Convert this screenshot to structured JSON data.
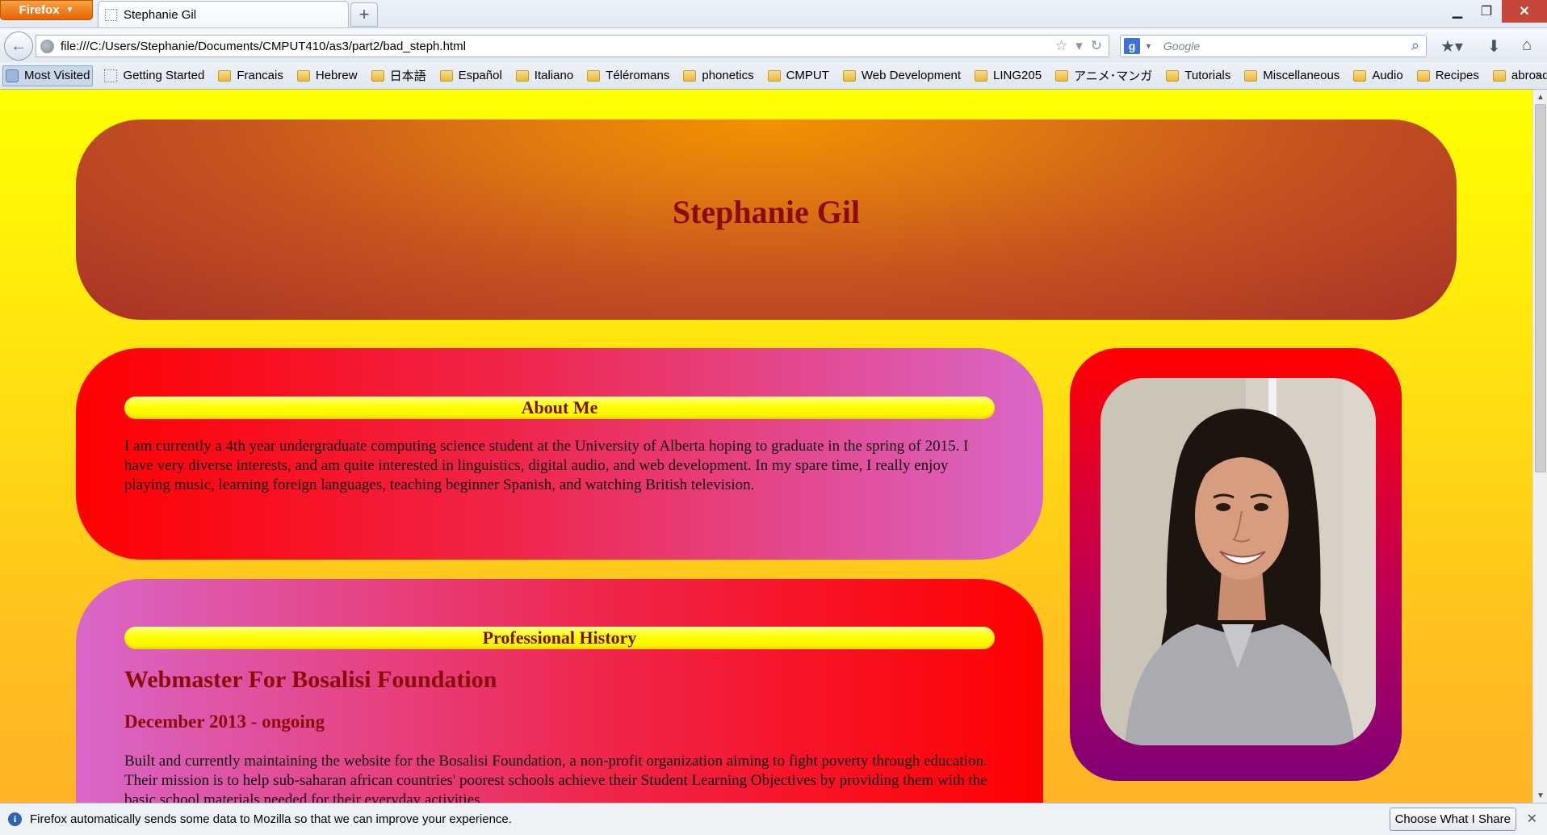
{
  "browser": {
    "app_button": "Firefox",
    "tab_title": "Stephanie Gil",
    "url": "file:///C:/Users/Stephanie/Documents/CMPUT410/as3/part2/bad_steph.html",
    "search_placeholder": "Google",
    "search_engine_letter": "g",
    "bookmarks": [
      "Most Visited",
      "Getting Started",
      "Francais",
      "Hebrew",
      "日本語",
      "Español",
      "Italiano",
      "Téléromans",
      "phonetics",
      "CMPUT",
      "Web Development",
      "LING205",
      "アニメ･マンガ",
      "Tutorials",
      "Miscellaneous",
      "Audio",
      "Recipes",
      "abroad"
    ],
    "notification": "Firefox automatically sends some data to Mozilla so that we can improve your experience.",
    "notification_button": "Choose What I Share"
  },
  "page": {
    "name": "Stephanie Gil",
    "about": {
      "heading": "About Me",
      "text": "I am currently a 4th year undergraduate computing science student at the University of Alberta hoping to graduate in the spring of 2015. I have very diverse interests, and am quite interested in linguistics, digital audio, and web development. In my spare time, I really enjoy playing music, learning foreign languages, teaching beginner Spanish, and watching British television."
    },
    "history": {
      "heading": "Professional History",
      "job_title": "Webmaster For Bosalisi Foundation",
      "job_date": "December 2013 - ongoing",
      "job_description": "Built and currently maintaining the website for the Bosalisi Foundation, a non-profit organization aiming to fight poverty through education. Their mission is to help sub-saharan african countries' poorest schools achieve their Student Learning Objectives by providing them with the basic school materials needed for their everyday activities."
    }
  },
  "colors": {
    "page_bg_top": "#ffff00",
    "page_bg_bottom": "#ffb327",
    "heading_text": "#8b0b0b",
    "firefox_orange": "#e66000"
  }
}
